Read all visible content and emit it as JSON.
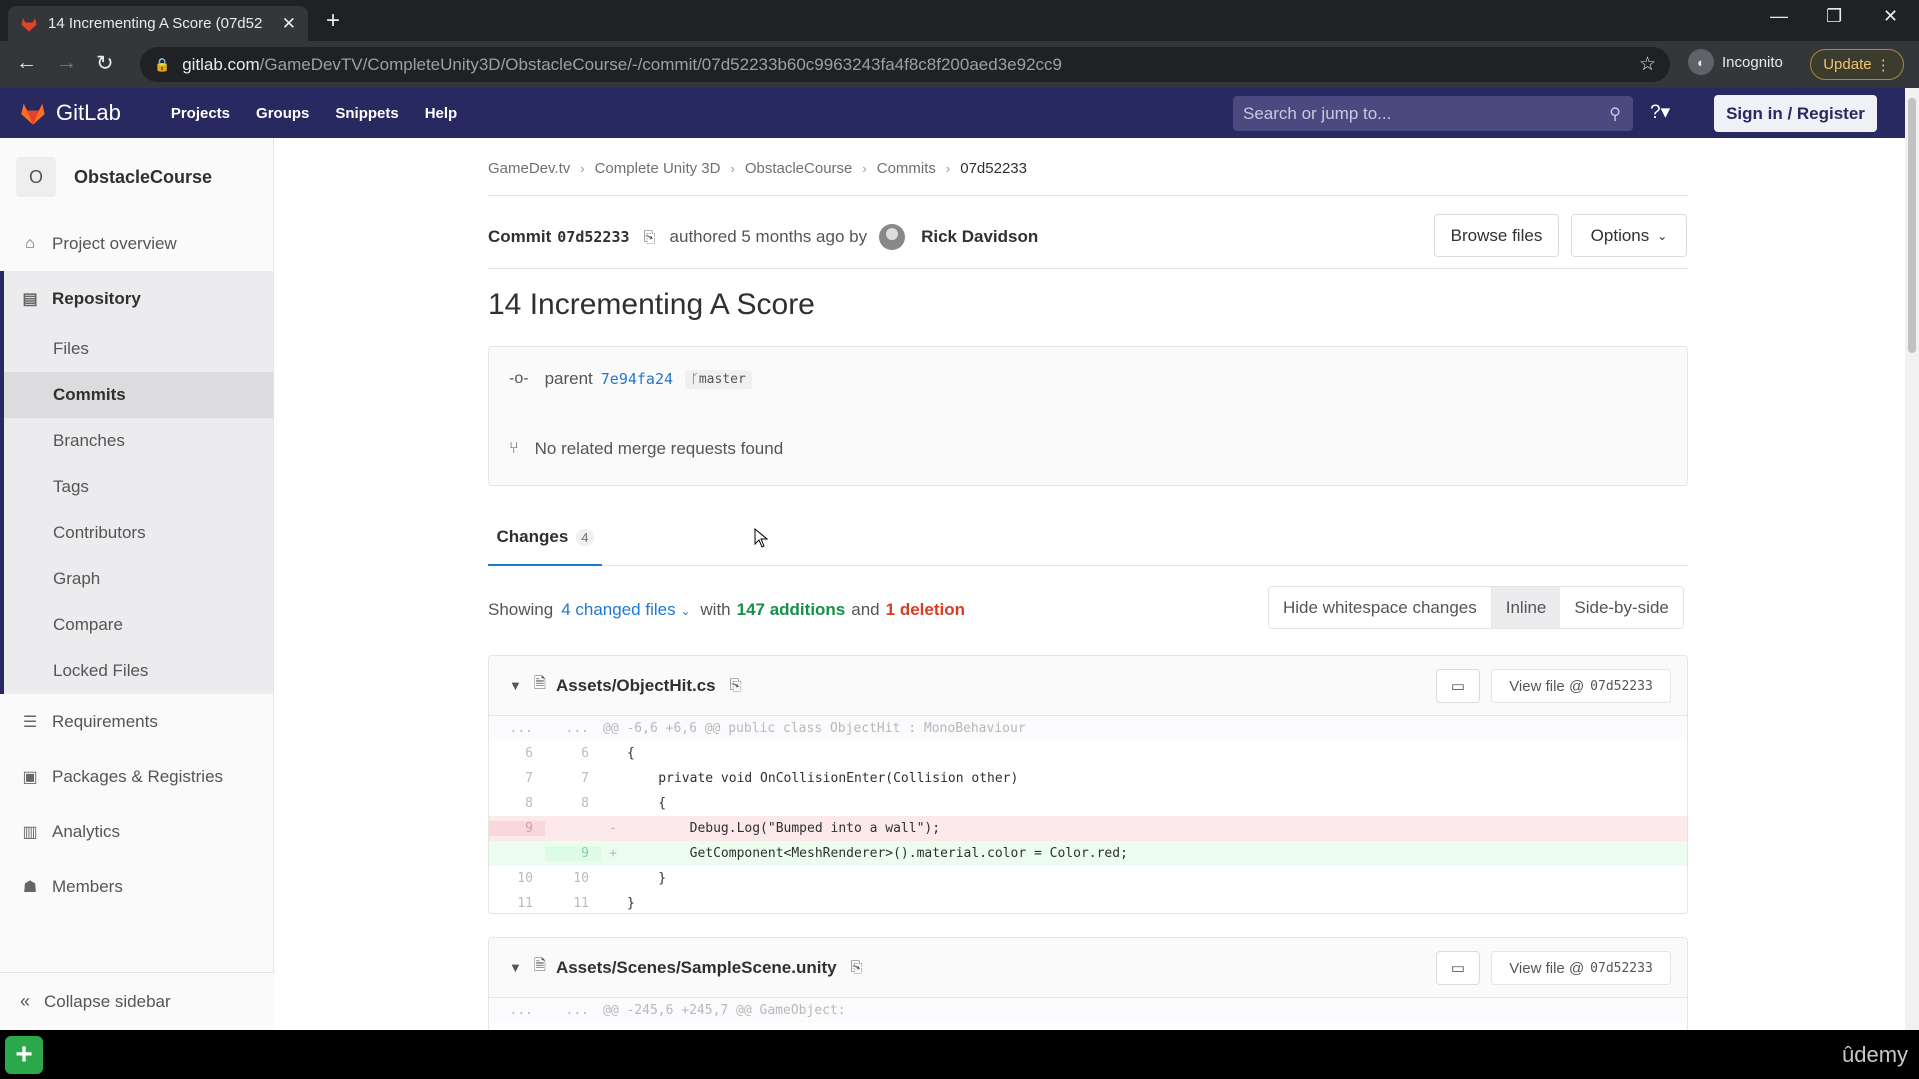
{
  "browser": {
    "tab_title": "14 Incrementing A Score (07d52",
    "url_host": "gitlab.com",
    "url_path": "/GameDevTV/CompleteUnity3D/ObstacleCourse/-/commit/07d52233b60c9963243fa4f8c8f200aed3e92cc9",
    "profile_label": "Incognito",
    "update_label": "Update"
  },
  "header": {
    "brand": "GitLab",
    "nav": [
      "Projects",
      "Groups",
      "Snippets",
      "Help"
    ],
    "search_placeholder": "Search or jump to...",
    "signin_label": "Sign in / Register"
  },
  "sidebar": {
    "project_initial": "O",
    "project_name": "ObstacleCourse",
    "items": [
      {
        "label": "Project overview",
        "icon": "home-icon"
      },
      {
        "label": "Repository",
        "icon": "doc-icon"
      },
      {
        "label": "Requirements",
        "icon": "list-icon"
      },
      {
        "label": "Packages & Registries",
        "icon": "package-icon"
      },
      {
        "label": "Analytics",
        "icon": "chart-icon"
      },
      {
        "label": "Members",
        "icon": "users-icon"
      }
    ],
    "repo_sub": [
      "Files",
      "Commits",
      "Branches",
      "Tags",
      "Contributors",
      "Graph",
      "Compare",
      "Locked Files"
    ],
    "collapse_label": "Collapse sidebar"
  },
  "breadcrumb": [
    "GameDev.tv",
    "Complete Unity 3D",
    "ObstacleCourse",
    "Commits",
    "07d52233"
  ],
  "commit": {
    "label": "Commit",
    "sha": "07d52233",
    "authored": "authored 5 months ago by",
    "author": "Rick Davidson",
    "browse_label": "Browse files",
    "options_label": "Options",
    "title": "14 Incrementing A Score",
    "parent_label": "parent",
    "parent_sha": "7e94fa24",
    "branch": "master",
    "merge_text": "No related merge requests found"
  },
  "tabs": {
    "changes_label": "Changes",
    "changes_count": "4"
  },
  "summary": {
    "showing": "Showing",
    "files": "4 changed files",
    "with": "with",
    "additions": "147 additions",
    "and": "and",
    "deletions": "1 deletion",
    "hide_ws": "Hide whitespace changes",
    "inline": "Inline",
    "side": "Side-by-side"
  },
  "files": [
    {
      "path": "Assets/ObjectHit.cs",
      "view_label": "View file @",
      "view_sha": "07d52233"
    },
    {
      "path": "Assets/Scenes/SampleScene.unity",
      "view_label": "View file @",
      "view_sha": "07d52233"
    }
  ],
  "diff1": {
    "hunk": "@@ -6,6 +6,6 @@ public class ObjectHit : MonoBehaviour",
    "lines": [
      {
        "old": "6",
        "new": "6",
        "code": "{"
      },
      {
        "old": "7",
        "new": "7",
        "code": "    private void OnCollisionEnter(Collision other)"
      },
      {
        "old": "8",
        "new": "8",
        "code": "    {"
      },
      {
        "old": "9",
        "new": "",
        "sign": "-",
        "code": "        Debug.Log(\"Bumped into a wall\");"
      },
      {
        "old": "",
        "new": "9",
        "sign": "+",
        "code": "        GetComponent<MeshRenderer>().material.color = Color.red;"
      },
      {
        "old": "10",
        "new": "10",
        "code": "    }"
      },
      {
        "old": "11",
        "new": "11",
        "code": "}"
      }
    ]
  },
  "diff2": {
    "hunk": "@@ -245,6 +245,7 @@ GameObject:"
  },
  "taskbar": {
    "watermark": "ûdemy"
  }
}
